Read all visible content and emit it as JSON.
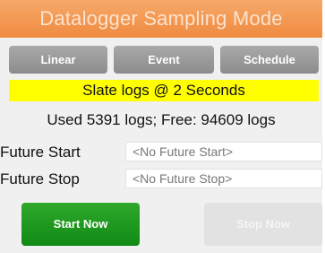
{
  "header": {
    "title": "Datalogger Sampling Mode"
  },
  "modes": [
    {
      "label": "Linear"
    },
    {
      "label": "Event"
    },
    {
      "label": "Schedule"
    }
  ],
  "rate_banner": "Slate logs @  2 Seconds",
  "usage_text": "Used 5391 logs; Free: 94609 logs",
  "future_start": {
    "label": "Future Start",
    "value": "<No Future Start>"
  },
  "future_stop": {
    "label": "Future Stop",
    "value": "<No Future Stop>"
  },
  "actions": {
    "start_label": "Start Now",
    "stop_label": "Stop Now"
  },
  "colors": {
    "titlebar": "#ef8a3f",
    "mode_button": "#9a9a9a",
    "rate_banner": "#ffff00",
    "start_button": "#1a9a1e",
    "stop_button_disabled": "#e2e2e2"
  }
}
